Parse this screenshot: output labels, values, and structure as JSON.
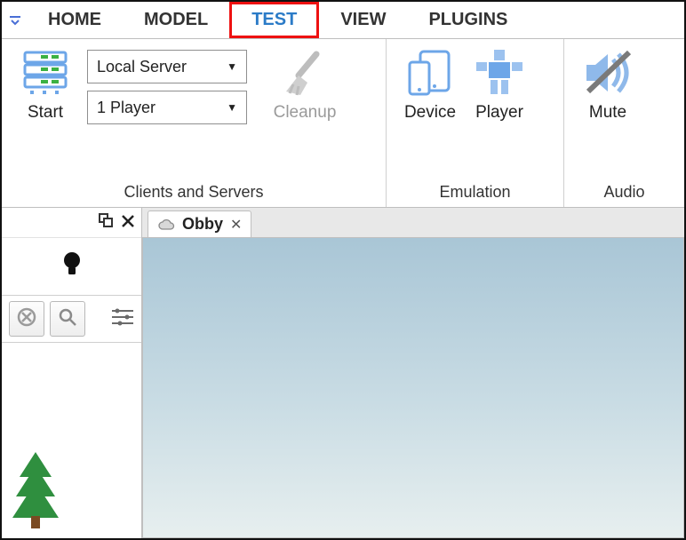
{
  "tabs": {
    "home": "HOME",
    "model": "MODEL",
    "test": "TEST",
    "view": "VIEW",
    "plugins": "PLUGINS",
    "active": "test"
  },
  "ribbon": {
    "start": {
      "label": "Start"
    },
    "server_combo": {
      "value": "Local Server"
    },
    "player_combo": {
      "value": "1 Player"
    },
    "cleanup": {
      "label": "Cleanup"
    },
    "device": {
      "label": "Device"
    },
    "player": {
      "label": "Player"
    },
    "mute": {
      "label": "Mute"
    },
    "groups": {
      "clients_servers": "Clients and Servers",
      "emulation": "Emulation",
      "audio": "Audio"
    }
  },
  "document": {
    "tab_title": "Obby"
  },
  "colors": {
    "accent": "#2b7bc7",
    "icon_blue": "#6da6e8",
    "highlight": "#e11"
  }
}
